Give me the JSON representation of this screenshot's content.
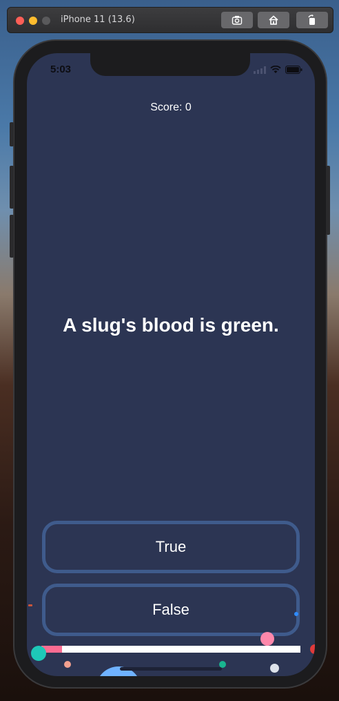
{
  "simulator": {
    "title": "iPhone 11 (13.6)",
    "buttons": [
      "screenshot-icon",
      "home-icon",
      "rotate-icon"
    ]
  },
  "status_bar": {
    "time": "5:03"
  },
  "quiz": {
    "score_text": "Score: 0",
    "question": "A slug's blood is green.",
    "true_label": "True",
    "false_label": "False",
    "progress": 0.08
  },
  "colors": {
    "background": "#2c3553",
    "button_border": "#3f5b8c",
    "progress_fill": "#fc6c92",
    "progress_track": "#ffffff"
  }
}
